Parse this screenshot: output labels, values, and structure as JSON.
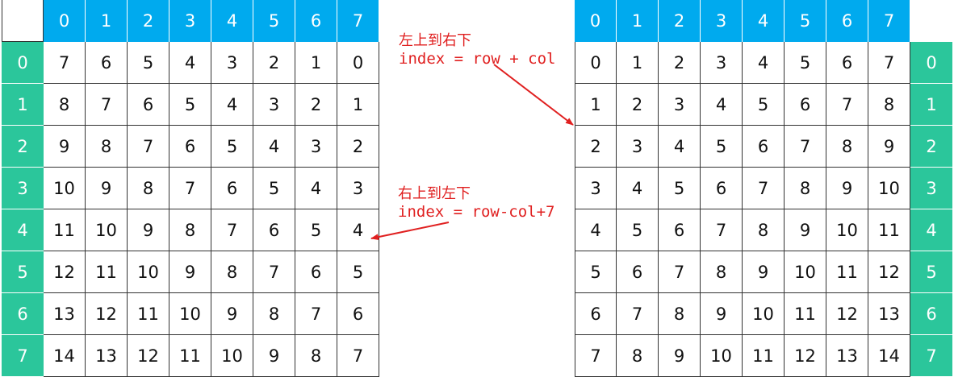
{
  "left_table": {
    "col_headers": [
      "0",
      "1",
      "2",
      "3",
      "4",
      "5",
      "6",
      "7"
    ],
    "row_headers": [
      "0",
      "1",
      "2",
      "3",
      "4",
      "5",
      "6",
      "7"
    ],
    "rows": [
      [
        "7",
        "6",
        "5",
        "4",
        "3",
        "2",
        "1",
        "0"
      ],
      [
        "8",
        "7",
        "6",
        "5",
        "4",
        "3",
        "2",
        "1"
      ],
      [
        "9",
        "8",
        "7",
        "6",
        "5",
        "4",
        "3",
        "2"
      ],
      [
        "10",
        "9",
        "8",
        "7",
        "6",
        "5",
        "4",
        "3"
      ],
      [
        "11",
        "10",
        "9",
        "8",
        "7",
        "6",
        "5",
        "4"
      ],
      [
        "12",
        "11",
        "10",
        "9",
        "8",
        "7",
        "6",
        "5"
      ],
      [
        "13",
        "12",
        "11",
        "10",
        "9",
        "8",
        "7",
        "6"
      ],
      [
        "14",
        "13",
        "12",
        "11",
        "10",
        "9",
        "8",
        "7"
      ]
    ]
  },
  "right_table": {
    "col_headers": [
      "0",
      "1",
      "2",
      "3",
      "4",
      "5",
      "6",
      "7"
    ],
    "row_headers": [
      "0",
      "1",
      "2",
      "3",
      "4",
      "5",
      "6",
      "7"
    ],
    "rows": [
      [
        "0",
        "1",
        "2",
        "3",
        "4",
        "5",
        "6",
        "7"
      ],
      [
        "1",
        "2",
        "3",
        "4",
        "5",
        "6",
        "7",
        "8"
      ],
      [
        "2",
        "3",
        "4",
        "5",
        "6",
        "7",
        "8",
        "9"
      ],
      [
        "3",
        "4",
        "5",
        "6",
        "7",
        "8",
        "9",
        "10"
      ],
      [
        "4",
        "5",
        "6",
        "7",
        "8",
        "9",
        "10",
        "11"
      ],
      [
        "5",
        "6",
        "7",
        "8",
        "9",
        "10",
        "11",
        "12"
      ],
      [
        "6",
        "7",
        "8",
        "9",
        "10",
        "11",
        "12",
        "13"
      ],
      [
        "7",
        "8",
        "9",
        "10",
        "11",
        "12",
        "13",
        "14"
      ]
    ]
  },
  "annotations": {
    "top_title": "左上到右下",
    "top_formula": "index = row + col",
    "bottom_title": "右上到左下",
    "bottom_formula": "index = row-col+7"
  },
  "colors": {
    "col_header_bg": "#00aaee",
    "row_header_bg": "#2bc69b",
    "annotation": "#e02020"
  }
}
